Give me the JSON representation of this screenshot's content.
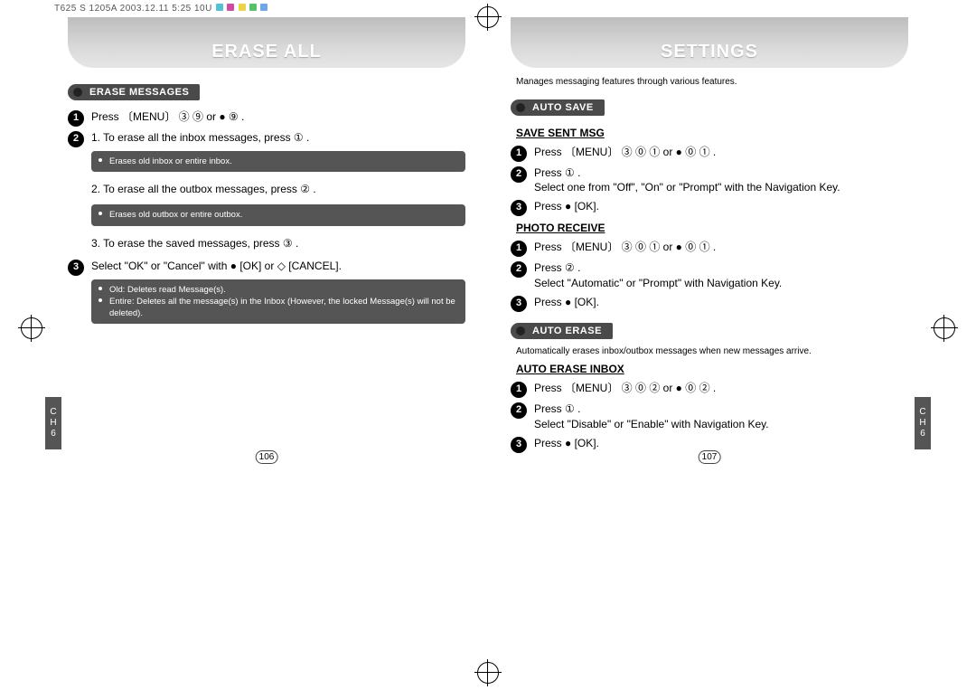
{
  "topbar": {
    "text": "T625   S  1205A  2003.12.11 5:25            10U"
  },
  "left_page": {
    "title": "ERASE ALL",
    "sidebar": "CH6",
    "pagenum": "106",
    "sections": {
      "erase_messages": {
        "tab": "ERASE MESSAGES",
        "step1": "Press  〔MENU〕 ③ ⑨ or ● ⑨ .",
        "step2_intro": "1. To erase all the inbox messages, press ① .",
        "note1": "Erases old inbox or entire inbox.",
        "step2_2": "2. To erase all the outbox messages, press ② .",
        "note2": "Erases old outbox or entire outbox.",
        "step2_3": "3. To erase the saved messages, press ③ .",
        "step3": "Select \"OK\" or \"Cancel\" with ● [OK] or ◇ [CANCEL].",
        "note3a": "Old: Deletes read Message(s).",
        "note3b": "Entire: Deletes all the message(s) in the Inbox (However, the locked Message(s) will not be deleted).",
        "menu_word": "[MENU]",
        "ok_word": "[OK]",
        "cancel_word": "[CANCEL]"
      }
    }
  },
  "right_page": {
    "title": "SETTINGS",
    "sidebar": "CH6",
    "pagenum": "107",
    "intro": "Manages messaging features through various features.",
    "auto_save": {
      "tab": "AUTO SAVE",
      "save_sent": {
        "heading": "SAVE SENT MSG",
        "s1": "Press  〔MENU〕 ③ ⓪ ① or ● ⓪ ① .",
        "s2": "Press ① .\nSelect one from \"Off\", \"On\" or \"Prompt\" with the Navigation Key.",
        "s3": "Press ● [OK]."
      },
      "photo_receive": {
        "heading": "PHOTO RECEIVE",
        "s1": "Press  〔MENU〕 ③ ⓪ ① or ● ⓪ ① .",
        "s2": "Press ② .\nSelect \"Automatic\" or \"Prompt\" with Navigation Key.",
        "s3": "Press ● [OK]."
      }
    },
    "auto_erase": {
      "tab": "AUTO ERASE",
      "note": "Automatically erases inbox/outbox messages when new messages arrive.",
      "inbox": {
        "heading": "AUTO ERASE INBOX",
        "s1": "Press  〔MENU〕 ③ ⓪ ② or ● ⓪ ② .",
        "s2": "Press ① .\nSelect \"Disable\" or \"Enable\" with Navigation Key.",
        "s3": "Press ● [OK]."
      }
    }
  }
}
